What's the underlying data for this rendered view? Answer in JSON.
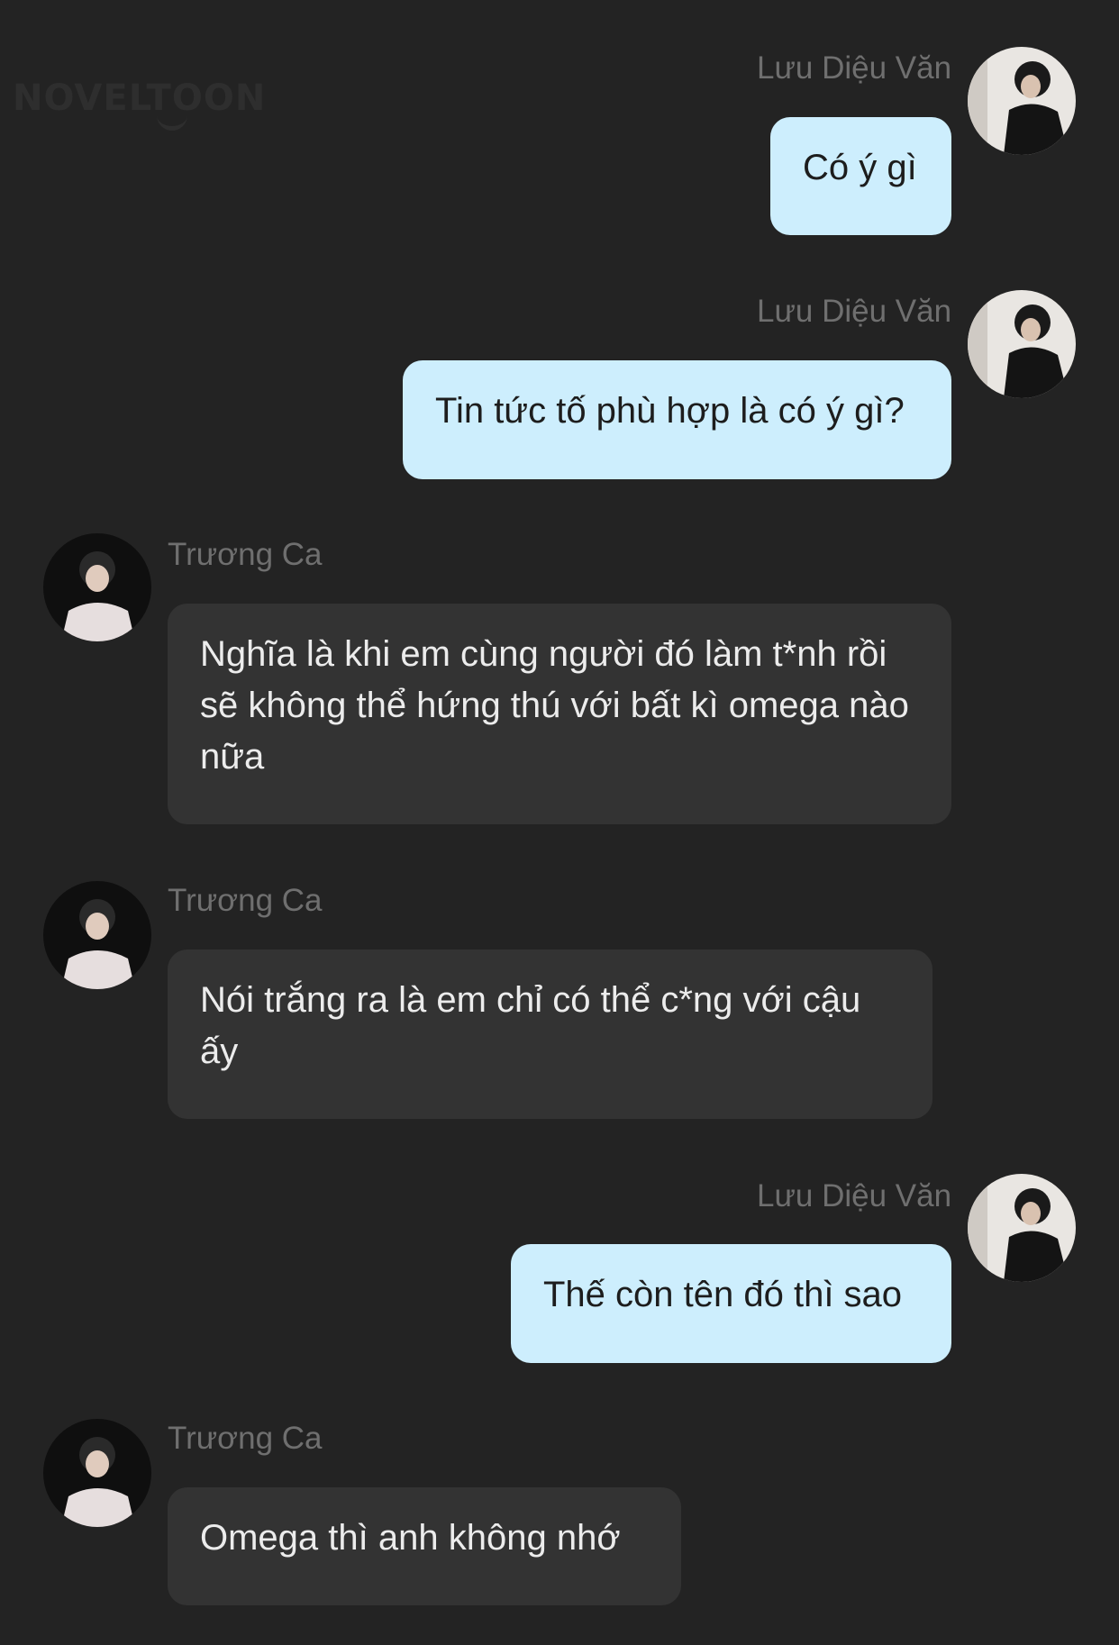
{
  "watermark": "NOVELTOON",
  "messages": [
    {
      "side": "right",
      "sender": "Lưu Diệu Văn",
      "text": "Có ý gì",
      "avatar_icon": "avatar-boy-dark-icon"
    },
    {
      "side": "right",
      "sender": "Lưu Diệu Văn",
      "text": "Tin tức tố phù hợp là có ý gì?",
      "avatar_icon": "avatar-boy-dark-icon"
    },
    {
      "side": "left",
      "sender": "Trương Ca",
      "text": "Nghĩa là khi em cùng người đó làm t*nh rồi sẽ không thể hứng thú với bất kì omega nào nữa",
      "avatar_icon": "avatar-boy-light-icon"
    },
    {
      "side": "left",
      "sender": "Trương Ca",
      "text": "Nói trắng ra là em chỉ có thể c*ng với cậu ấy",
      "avatar_icon": "avatar-boy-light-icon"
    },
    {
      "side": "right",
      "sender": "Lưu Diệu Văn",
      "text": "Thế còn tên đó thì sao",
      "avatar_icon": "avatar-boy-dark-icon"
    },
    {
      "side": "left",
      "sender": "Trương Ca",
      "text": "Omega thì anh không nhớ",
      "avatar_icon": "avatar-boy-light-icon"
    }
  ],
  "colors": {
    "background": "#232323",
    "right_bubble": "#cdeefd",
    "left_bubble": "#333333",
    "name": "#6f6f6f"
  }
}
